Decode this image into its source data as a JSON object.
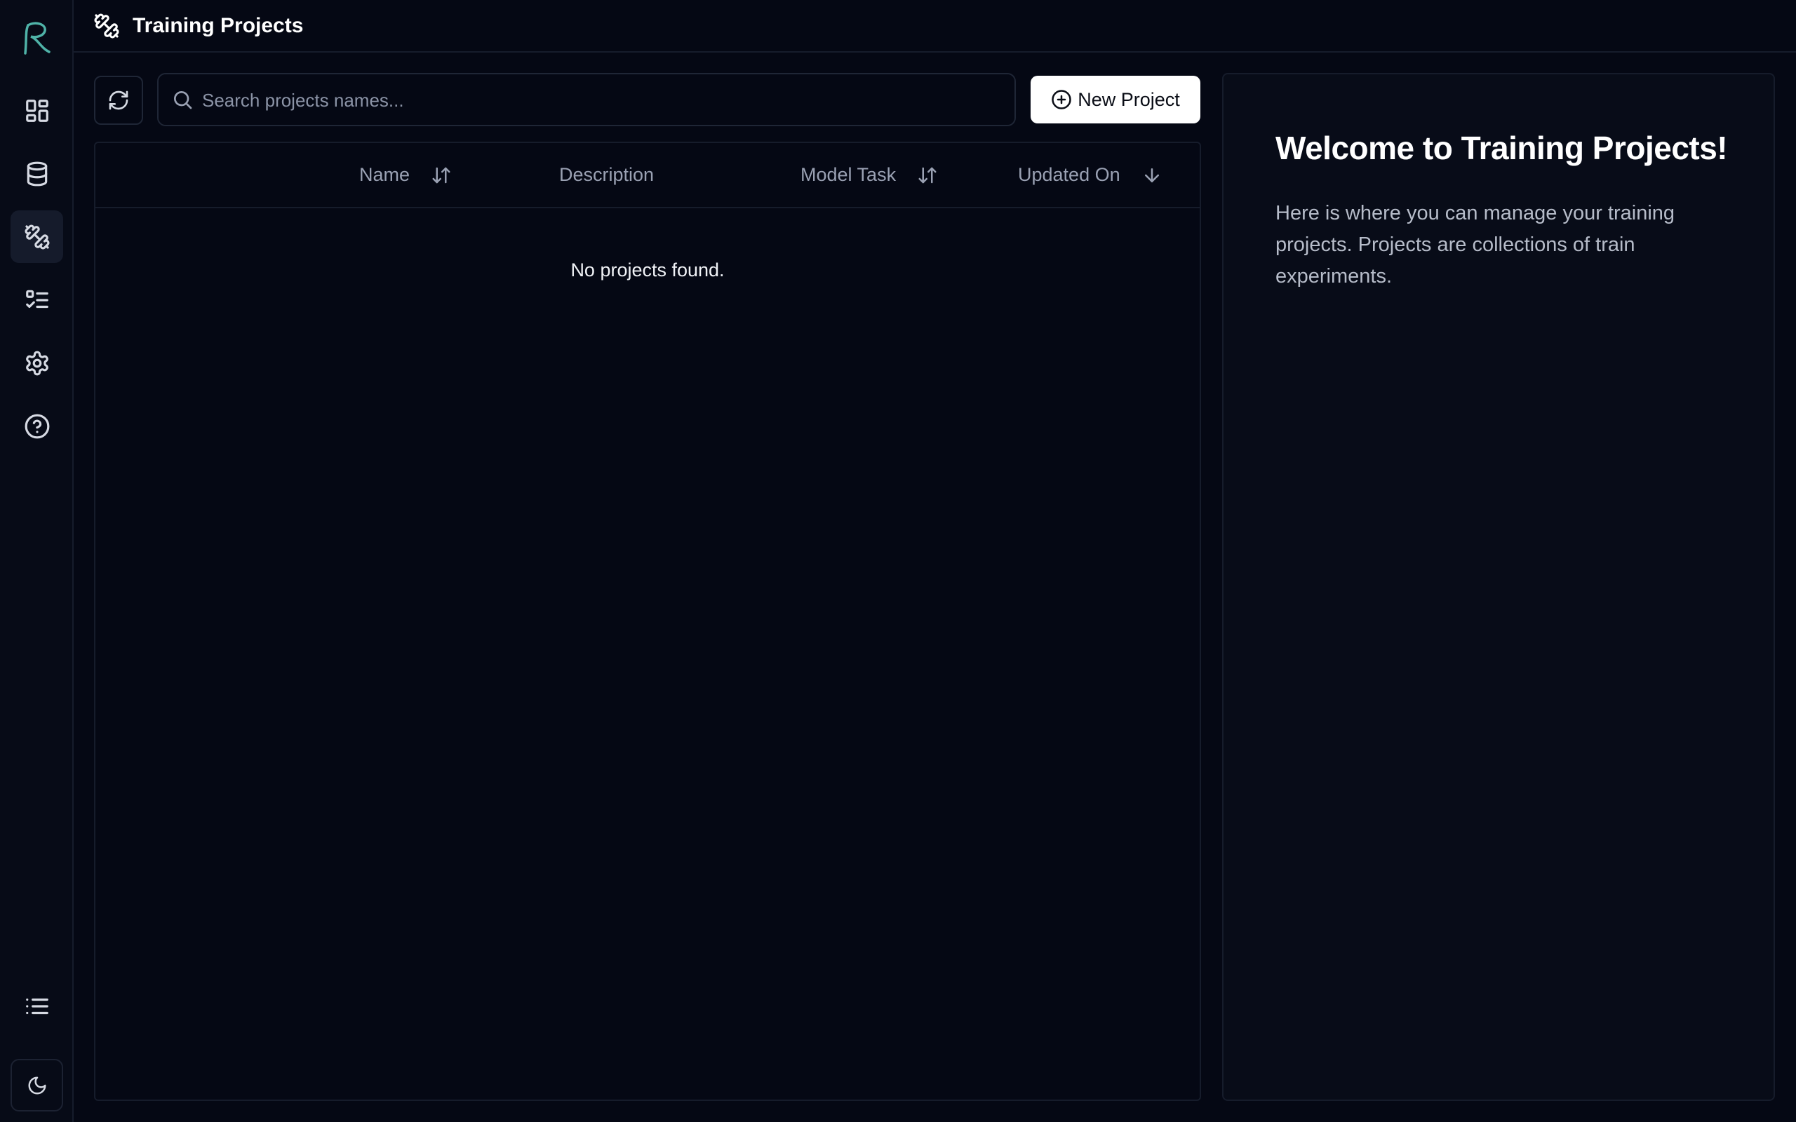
{
  "app": {
    "page_title": "Training Projects"
  },
  "sidebar": {
    "items": [
      {
        "name": "dashboard",
        "icon": "dashboard-icon"
      },
      {
        "name": "datasets",
        "icon": "database-icon"
      },
      {
        "name": "training-projects",
        "icon": "dumbbell-icon",
        "active": true
      },
      {
        "name": "tasks",
        "icon": "checklist-icon"
      },
      {
        "name": "settings",
        "icon": "gear-icon"
      },
      {
        "name": "help",
        "icon": "help-icon"
      }
    ],
    "bottom": [
      {
        "name": "list",
        "icon": "list-icon"
      },
      {
        "name": "theme-toggle",
        "icon": "moon-icon"
      }
    ]
  },
  "toolbar": {
    "search_placeholder": "Search projects names...",
    "new_project_label": "New Project"
  },
  "table": {
    "columns": [
      {
        "label": "Name",
        "sort": "both"
      },
      {
        "label": "Description",
        "sort": "none"
      },
      {
        "label": "Model Task",
        "sort": "both"
      },
      {
        "label": "Updated On",
        "sort": "desc"
      }
    ],
    "empty_message": "No projects found."
  },
  "welcome_panel": {
    "title": "Welcome to Training Projects!",
    "body": "Here is where you can manage your training projects. Projects are collections of train experiments."
  },
  "colors": {
    "background": "#050814",
    "accent_logo": "#4fb3a8",
    "primary_button": "#ffffff"
  }
}
